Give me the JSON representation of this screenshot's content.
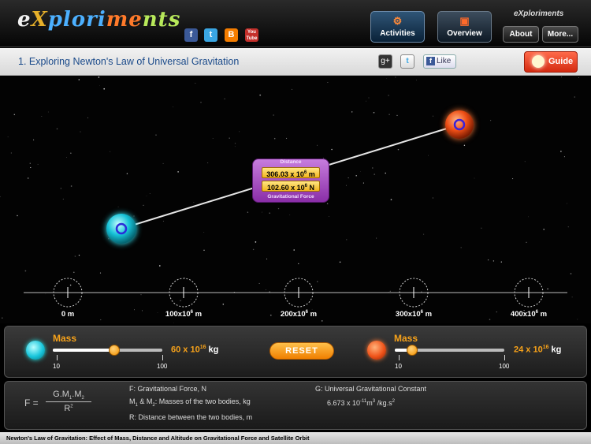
{
  "header": {
    "logo_parts": [
      "e",
      "X",
      "plori",
      "me",
      "nts"
    ],
    "brand_small": "eXploriments",
    "social_icons": [
      "facebook-icon",
      "twitter-icon",
      "blogger-icon",
      "youtube-icon"
    ],
    "youtube_text": "You Tube",
    "nav": [
      {
        "label": "Activities",
        "icon": "wrench-icon",
        "active": true
      },
      {
        "label": "Overview",
        "icon": "presentation-icon",
        "active": false
      }
    ],
    "about_label": "About",
    "more_label": "More..."
  },
  "titlebar": {
    "title": "1. Exploring Newton's Law of Universal Gravitation",
    "gplus_label": "g+",
    "twitter_label": "t",
    "like_label": "Like",
    "guide_label": "Guide"
  },
  "simulation": {
    "readout": {
      "distance_label": "Distance",
      "distance_value": "306.03 x 10",
      "distance_exp": "6",
      "distance_unit": " m",
      "force_value": "102.60 x 10",
      "force_exp": "6",
      "force_unit": " N",
      "force_label": "Gravitational Force"
    },
    "scale_ticks": [
      {
        "base": "0 m",
        "exp": "",
        "unit": ""
      },
      {
        "base": "100x10",
        "exp": "6",
        "unit": " m"
      },
      {
        "base": "200x10",
        "exp": "6",
        "unit": " m"
      },
      {
        "base": "300x10",
        "exp": "6",
        "unit": " m"
      },
      {
        "base": "400x10",
        "exp": "6",
        "unit": " m"
      }
    ]
  },
  "controls": {
    "body1": {
      "mass_label": "Mass",
      "min": "10",
      "max": "100",
      "slider_fraction": 0.56,
      "value_text": "60 x 10",
      "value_exp": "16",
      "unit": " kg"
    },
    "reset_label": "RESET",
    "body2": {
      "mass_label": "Mass",
      "min": "10",
      "max": "100",
      "slider_fraction": 0.156,
      "value_text": "24 x 10",
      "value_exp": "16",
      "unit": " kg"
    }
  },
  "formula": {
    "lhs": "F =",
    "numerator": "G.M",
    "numerator_sub1": "1",
    "numerator_mid": ".M",
    "numerator_sub2": "2",
    "denominator": "R",
    "denominator_exp": "2",
    "def_f": "F: Gravitational Force, N",
    "def_m_pre": "M",
    "def_m_sub1": "1",
    "def_m_mid": " & M",
    "def_m_sub2": "2",
    "def_m_post": ": Masses of the two bodies, kg",
    "def_r": "R: Distance between the two bodies, m",
    "def_g": "G: Universal Gravitational Constant",
    "g_value_pre": "6.673 x 10",
    "g_value_exp1": "-11",
    "g_value_mid": "m",
    "g_value_exp2": "3",
    "g_value_mid2": " /kg.s",
    "g_value_exp3": "2"
  },
  "footer": {
    "text": "Newton's Law of Gravitation: Effect of Mass, Distance and Altitude on Gravitational Force and Satellite Orbit"
  },
  "colors": {
    "accent_orange": "#f7a21a",
    "title_blue": "#1a4a8a",
    "body1": "#18c6dc",
    "body2": "#f0541a",
    "readout_purple": "#8a2ea8"
  }
}
